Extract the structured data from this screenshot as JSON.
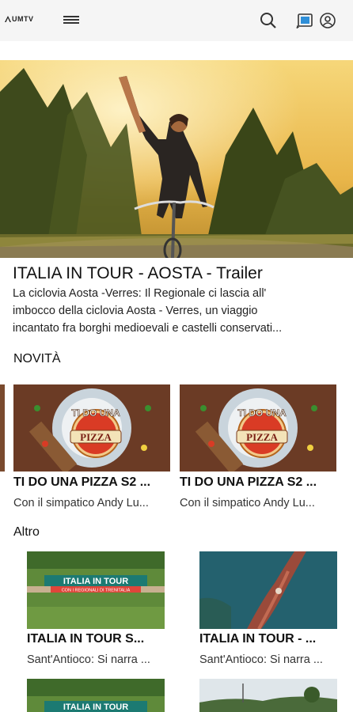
{
  "header": {
    "logo_text": "UMTV"
  },
  "hero": {
    "title": "ITALIA IN TOUR - AOSTA - Trailer",
    "description_lines": [
      "La ciclovia Aosta -Verres: Il Regionale ci lascia all'",
      "imbocco della ciclovia Aosta - Verres, un viaggio",
      "incantato fra borghi medioevali e castelli conservati..."
    ]
  },
  "sections": {
    "novita": {
      "title": "NOVITÀ",
      "cards": [
        {
          "title": "TI DO UNA PIZZA S2 ...",
          "subtitle": "Con il simpatico Andy Lu...",
          "thumb_text": [
            "TI DO UNA",
            "PIZZA"
          ]
        },
        {
          "title": "TI DO UNA PIZZA S2 ...",
          "subtitle": "Con il simpatico Andy Lu...",
          "thumb_text": [
            "TI DO UNA",
            "PIZZA"
          ]
        }
      ]
    },
    "altro": {
      "title": "Altro",
      "cards": [
        {
          "title": "ITALIA IN TOUR S...",
          "subtitle": "Sant'Antioco: Si narra ...",
          "thumb_text": [
            "ITALIA IN TOUR",
            "CON I REGIONALI DI TRENITALIA"
          ]
        },
        {
          "title": "ITALIA IN TOUR - ...",
          "subtitle": "Sant'Antioco: Si narra ..."
        }
      ],
      "row2_thumb_text": "ITALIA IN TOUR"
    }
  }
}
